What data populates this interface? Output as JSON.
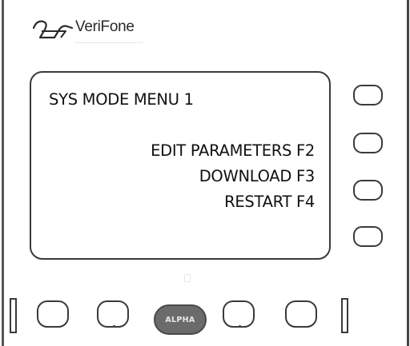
{
  "device": {
    "brand": "VeriFone",
    "brand_logo_icon": "verifone-logo-icon"
  },
  "screen": {
    "title": "SYS MODE MENU 1",
    "menu": [
      {
        "label": "EDIT PARAMETERS F2"
      },
      {
        "label": "DOWNLOAD F3"
      },
      {
        "label": "RESTART F4"
      }
    ]
  },
  "keys": {
    "alpha_label": "ALPHA"
  }
}
